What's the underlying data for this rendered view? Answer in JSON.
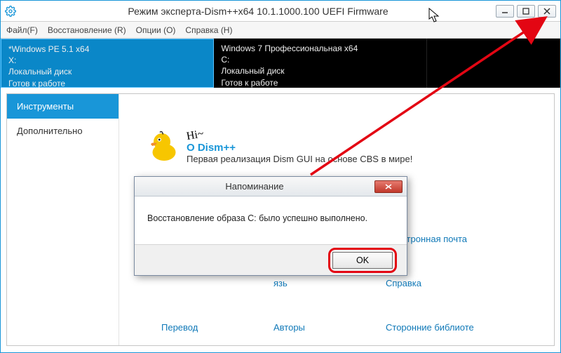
{
  "window": {
    "title": "Режим эксперта-Dism++x64 10.1.1000.100 UEFI Firmware"
  },
  "menu": {
    "file": "Файл(F)",
    "recover": "Восстановление (R)",
    "options": "Опции (O)",
    "help": "Справка (H)"
  },
  "images": {
    "left": {
      "l1": "*Windows PE 5.1 x64",
      "l2": "X:",
      "l3": "Локальный диск",
      "l4": "Готов к работе"
    },
    "right": {
      "l1": "Windows 7 Профессиональная x64",
      "l2": "C:",
      "l3": "Локальный диск",
      "l4": "Готов к работе"
    }
  },
  "sidebar": {
    "tools": "Инструменты",
    "extra": "Дополнительно"
  },
  "hero": {
    "hi": "Hi~",
    "title": "О Dism++",
    "subtitle": "Первая реализация Dism GUI на основе CBS в мире!"
  },
  "links": {
    "r1c1": "",
    "r1c2": "",
    "r1c3": "Электронная почта",
    "r2c1": "",
    "r2c2": "язь",
    "r2c3": "Справка",
    "r3c1": "Перевод",
    "r3c2": "Авторы",
    "r3c3": "Сторонние библиоте"
  },
  "dialog": {
    "title": "Напоминание",
    "body": "Восстановление образа C: было успешно выполнено.",
    "ok": "OK"
  }
}
